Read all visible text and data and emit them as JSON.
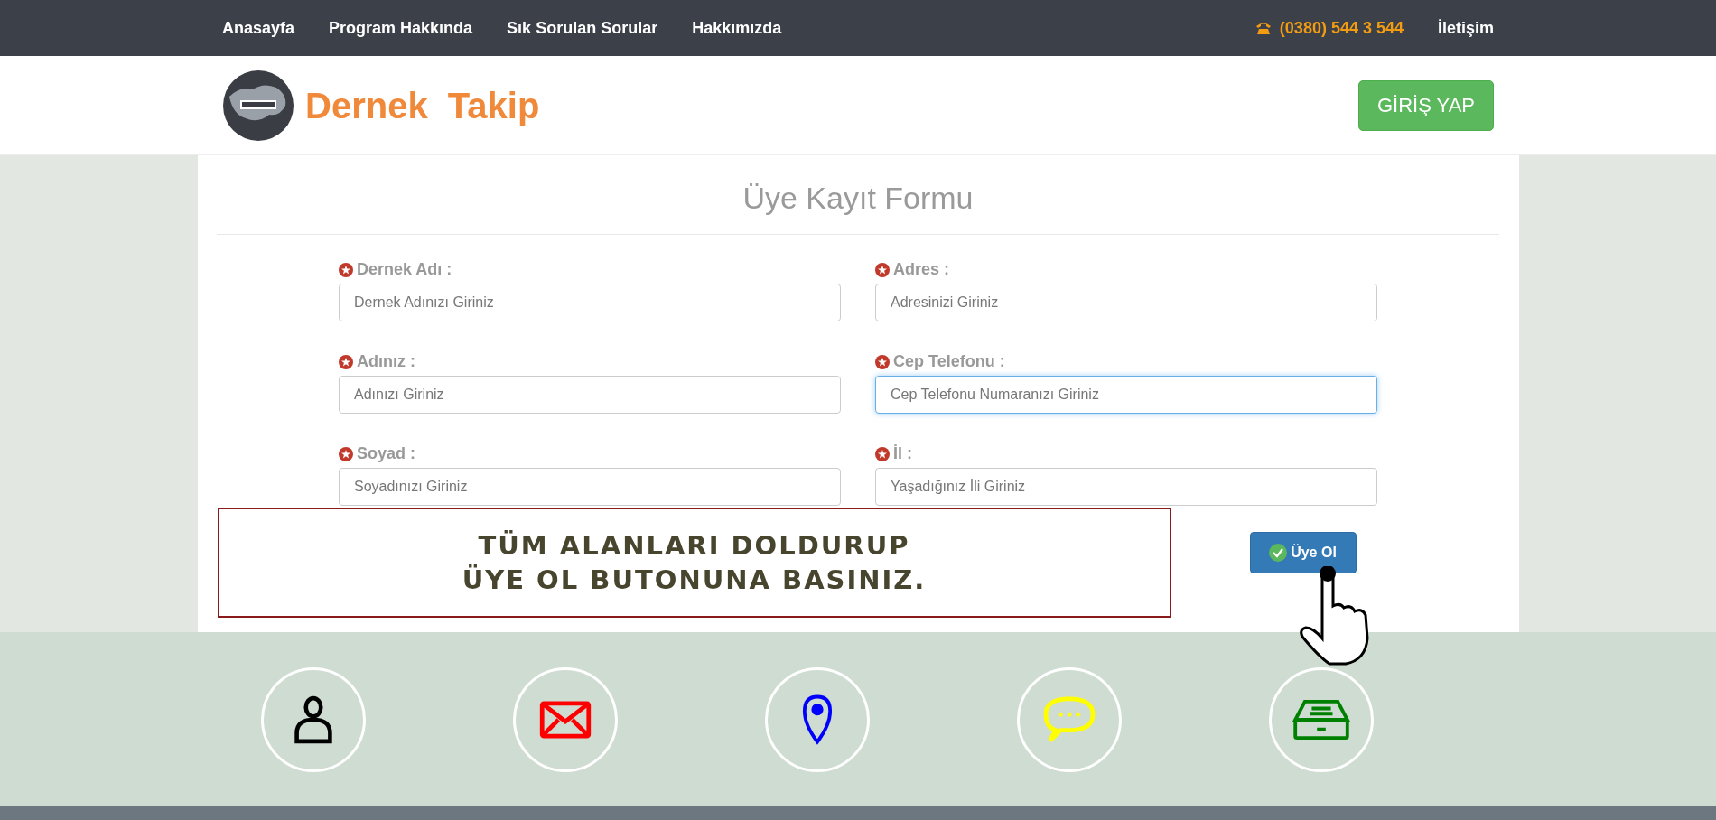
{
  "nav": {
    "links": [
      {
        "label": "Anasayfa"
      },
      {
        "label": "Program Hakkında"
      },
      {
        "label": "Sık Sorulan Sorular"
      },
      {
        "label": "Hakkımızda"
      }
    ],
    "phone": "(0380) 544 3 544",
    "contact": "İletişim"
  },
  "header": {
    "logo_text": "Dernek  Takip",
    "login_button": "GİRİŞ YAP"
  },
  "form": {
    "title": "Üye Kayıt Formu",
    "fields": [
      {
        "label": "Dernek Adı :",
        "placeholder": "Dernek Adınızı Giriniz",
        "focused": false
      },
      {
        "label": "Adres :",
        "placeholder": "Adresinizi Giriniz",
        "focused": false
      },
      {
        "label": "Adınız :",
        "placeholder": "Adınızı Giriniz",
        "focused": false
      },
      {
        "label": "Cep Telefonu :",
        "placeholder": "Cep Telefonu Numaranızı Giriniz",
        "focused": true
      },
      {
        "label": "Soyad :",
        "placeholder": "Soyadınızı Giriniz",
        "focused": false
      },
      {
        "label": "İl :",
        "placeholder": "Yaşadığınız İli Giriniz",
        "focused": false
      }
    ],
    "notice": [
      "TÜM ALANLARI DOLDURUP",
      "ÜYE OL BUTONUNA BASINIZ."
    ],
    "submit_button": "Üye Ol"
  },
  "footer": {
    "icons": [
      {
        "kind": "person",
        "color": "#000000"
      },
      {
        "kind": "mail",
        "color": "#ff0000"
      },
      {
        "kind": "pin",
        "color": "#0000ff"
      },
      {
        "kind": "chat",
        "color": "#ffff00"
      },
      {
        "kind": "inbox",
        "color": "#008000"
      }
    ]
  }
}
